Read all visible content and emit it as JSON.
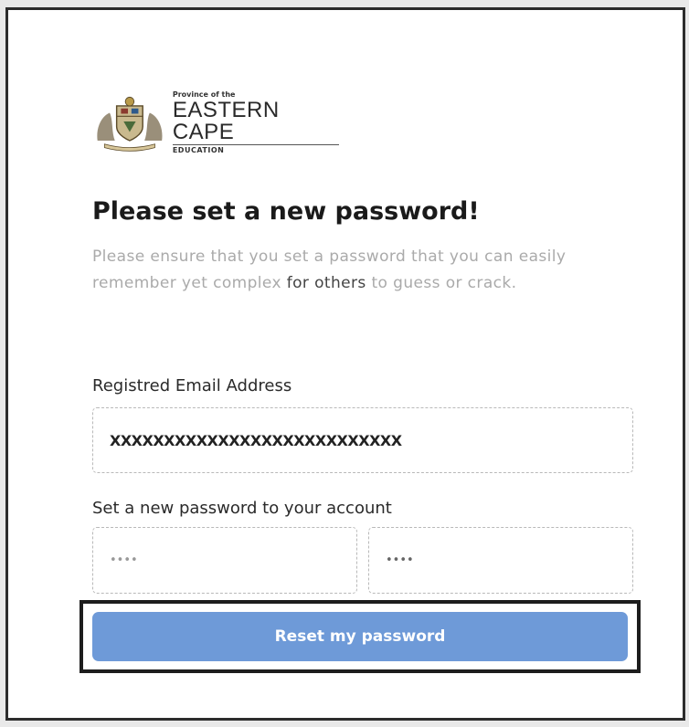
{
  "logo": {
    "line1": "Province of the",
    "line2": "EASTERN CAPE",
    "line3": "EDUCATION"
  },
  "heading": "Please set a new password!",
  "description": {
    "part1": "Please ensure that you set a password that you can easily remember yet complex ",
    "part2": "for others",
    "part3": " to guess or crack."
  },
  "email": {
    "label": "Registred Email Address",
    "value": "XXXXXXXXXXXXXXXXXXXXXXXXXXX"
  },
  "password": {
    "label": "Set a new password to your account",
    "new_value": "••••",
    "confirm_value": "••••"
  },
  "submit": {
    "label": "Reset my password"
  },
  "colors": {
    "button_bg": "#6e9ad8",
    "button_text": "#ffffff",
    "heading_text": "#1a1a1a",
    "muted_text": "#aaaaaa"
  }
}
